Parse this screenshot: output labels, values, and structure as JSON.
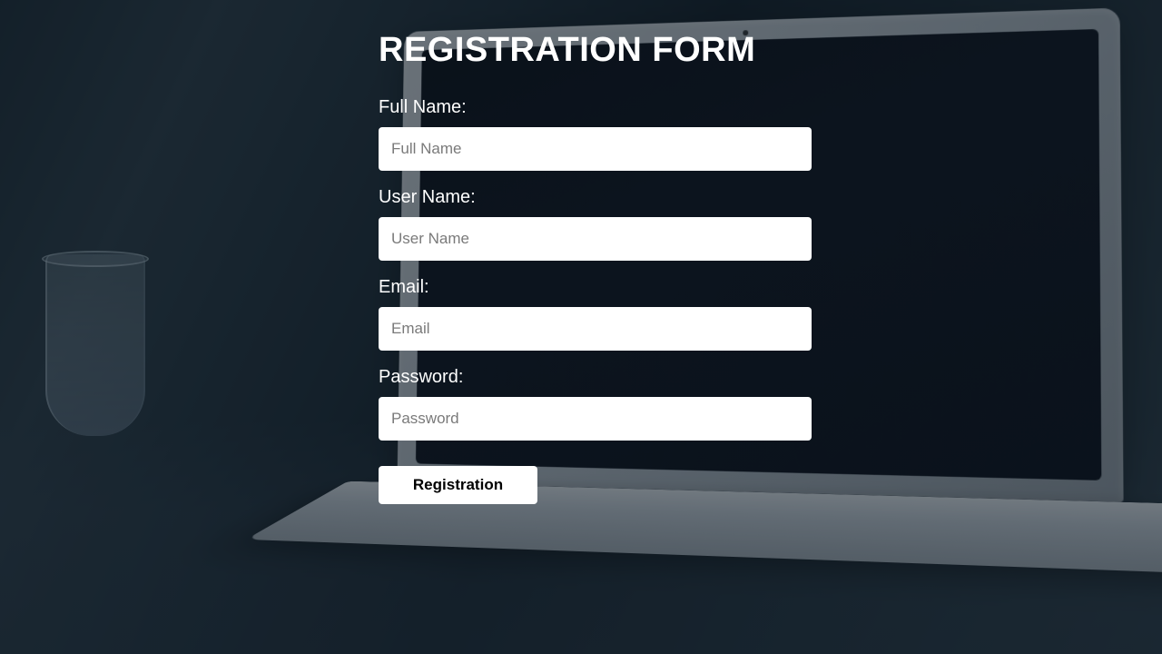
{
  "form": {
    "title": "REGISTRATION FORM",
    "fields": {
      "fullname": {
        "label": "Full Name:",
        "placeholder": "Full Name",
        "value": ""
      },
      "username": {
        "label": "User Name:",
        "placeholder": "User Name",
        "value": ""
      },
      "email": {
        "label": "Email:",
        "placeholder": "Email",
        "value": ""
      },
      "password": {
        "label": "Password:",
        "placeholder": "Password",
        "value": ""
      }
    },
    "submit_label": "Registration"
  }
}
